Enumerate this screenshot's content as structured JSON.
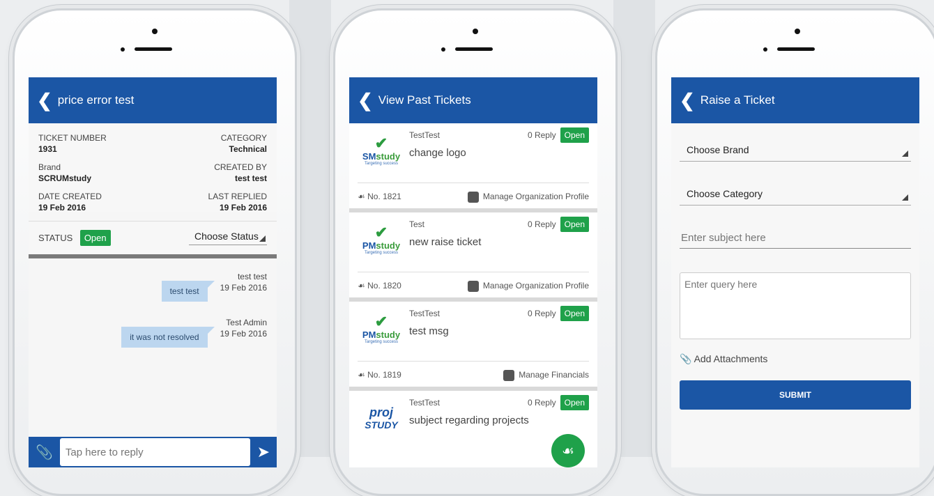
{
  "screen1": {
    "title": "price error test",
    "ticket_number_label": "TICKET NUMBER",
    "ticket_number": "1931",
    "category_label": "CATEGORY",
    "category": "Technical",
    "brand_label": "Brand",
    "brand": "SCRUMstudy",
    "created_by_label": "CREATED BY",
    "created_by": "test test",
    "date_created_label": "DATE CREATED",
    "date_created": "19 Feb 2016",
    "last_replied_label": "LAST REPLIED",
    "last_replied": "19 Feb 2016",
    "status_label": "STATUS",
    "status": "Open",
    "choose_status": "Choose Status",
    "messages": [
      {
        "text": "test test",
        "author": "test test",
        "date": "19 Feb 2016"
      },
      {
        "text": "it was not resolved",
        "author": "Test Admin",
        "date": "19 Feb 2016"
      }
    ],
    "reply_placeholder": "Tap here to reply"
  },
  "screen2": {
    "title": "View Past Tickets",
    "tickets": [
      {
        "user": "TestTest",
        "subject": "change logo",
        "replies": "0 Reply",
        "status": "Open",
        "number": "No. 1821",
        "module": "Manage Organization Profile",
        "brand_prefix": "SM",
        "brand_suffix": "study",
        "tagline": "Targeting success"
      },
      {
        "user": "Test",
        "subject": "new raise ticket",
        "replies": "0 Reply",
        "status": "Open",
        "number": "No. 1820",
        "module": "Manage Organization Profile",
        "brand_prefix": "PM",
        "brand_suffix": "study",
        "tagline": "Targeting success"
      },
      {
        "user": "TestTest",
        "subject": "test msg",
        "replies": "0 Reply",
        "status": "Open",
        "number": "No. 1819",
        "module": "Manage Financials",
        "brand_prefix": "PM",
        "brand_suffix": "study",
        "tagline": "Targeting success"
      },
      {
        "user": "TestTest",
        "subject": "subject regarding projects",
        "replies": "0 Reply",
        "status": "Open",
        "brand_prefix": "proj",
        "brand_suffix": "STUDY",
        "tagline": ""
      }
    ]
  },
  "screen3": {
    "title": "Raise a Ticket",
    "choose_brand": "Choose Brand",
    "choose_category": "Choose Category",
    "subject_placeholder": "Enter subject here",
    "query_placeholder": "Enter query here",
    "add_attachments": "Add Attachments",
    "submit_label": "SUBMIT"
  }
}
